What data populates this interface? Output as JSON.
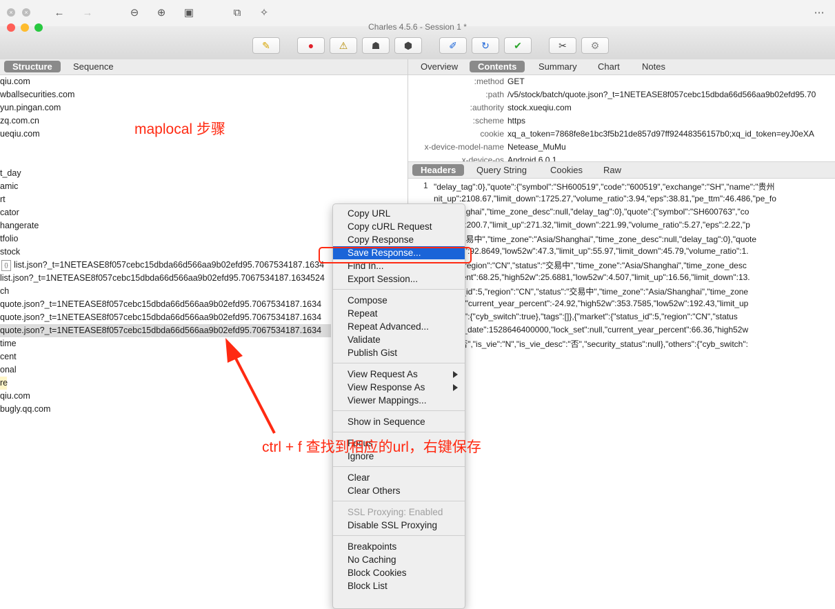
{
  "window": {
    "title": "Charles 4.5.6 - Session 1 *"
  },
  "left_tabs": [
    "Structure",
    "Sequence"
  ],
  "tree": [
    "qiu.com",
    "wballsecurities.com",
    "yun.pingan.com",
    "zq.com.cn",
    "ueqiu.com",
    "",
    "",
    "t_day",
    "amic",
    "rt",
    "cator",
    "hangerate",
    "tfolio",
    "stock",
    "list.json?_t=1NETEASE8f057cebc15dbda66d566aa9b02efd95.7067534187.1634",
    "list.json?_t=1NETEASE8f057cebc15dbda66d566aa9b02efd95.7067534187.1634524",
    "ch",
    "quote.json?_t=1NETEASE8f057cebc15dbda66d566aa9b02efd95.7067534187.1634",
    "quote.json?_t=1NETEASE8f057cebc15dbda66d566aa9b02efd95.7067534187.1634",
    "quote.json?_t=1NETEASE8f057cebc15dbda66d566aa9b02efd95.7067534187.1634",
    "time",
    "cent",
    "onal",
    "re",
    "qiu.com",
    "bugly.qq.com"
  ],
  "right_tabs": [
    "Overview",
    "Contents",
    "Summary",
    "Chart",
    "Notes"
  ],
  "request_headers": [
    {
      "key": ":method",
      "value": "GET"
    },
    {
      "key": ":path",
      "value": "/v5/stock/batch/quote.json?_t=1NETEASE8f057cebc15dbda66d566aa9b02efd95.70"
    },
    {
      "key": ":authority",
      "value": "stock.xueqiu.com"
    },
    {
      "key": ":scheme",
      "value": "https"
    },
    {
      "key": "cookie",
      "value": "xq_a_token=7868fe8e1bc3f5b21de857d97ff92448356157b0;xq_id_token=eyJ0eXA"
    },
    {
      "key": "x-device-model-name",
      "value": "Netease_MuMu"
    },
    {
      "key": "x-device-os",
      "value": "Android 6.0.1"
    }
  ],
  "bottom_tabs": [
    "Headers",
    "Query String",
    "Cookies",
    "Raw"
  ],
  "line_number": "1",
  "response_lines": [
    "\"delay_tag\":0},\"quote\":{\"symbol\":\"SH600519\",\"code\":\"600519\",\"exchange\":\"SH\",\"name\":\"贵州",
    "nit_up\":2108.67,\"limit_down\":1725.27,\"volume_ratio\":3.94,\"eps\":38.81,\"pe_ttm\":46.486,\"pe_fo",
    "sia/Shanghai\",\"time_zone_desc\":null,\"delay_tag\":0},\"quote\":{\"symbol\":\"SH600763\",\"co",
    "low52w\":200.7,\"limit_up\":271.32,\"limit_down\":221.99,\"volume_ratio\":5.27,\"eps\":2.22,\"p",
    "atus\":\"交易中\",\"time_zone\":\"Asia/Shanghai\",\"time_zone_desc\":null,\"delay_tag\":0},\"quote",
    "high52w\":92.8649,\"low52w\":47.3,\"limit_up\":55.97,\"limit_down\":45.79,\"volume_ratio\":1.",
    "s_id\":5,\"region\":\"CN\",\"status\":\"交易中\",\"time_zone\":\"Asia/Shanghai\",\"time_zone_desc",
    "ar_percent\":68.25,\"high52w\":25.6881,\"low52w\":4.507,\"limit_up\":16.56,\"limit_down\":13.",
    "{\"status_id\":5,\"region\":\"CN\",\"status\":\"交易中\",\"time_zone\":\"Asia/Shanghai\",\"time_zone",
    "set\":null,\"current_year_percent\":-24.92,\"high52w\":353.7585,\"low52w\":192.43,\"limit_up",
    "},\"others\":{\"cyb_switch\":true},\"tags\":[]},{\"market\":{\"status_id\":5,\"region\":\"CN\",\"status",
    "2,\"issue_date\":1528646400000,\"lock_set\":null,\"current_year_percent\":66.36,\"high52w",
    "desc\":\"否\",\"is_vie\":\"N\",\"is_vie_desc\":\"否\",\"security_status\":null},\"others\":{\"cyb_switch\":"
  ],
  "context_menu": {
    "groups": [
      [
        "Copy URL",
        "Copy cURL Request",
        "Copy Response",
        "Save Response...",
        "Find In...",
        "Export Session..."
      ],
      [
        "Compose",
        "Repeat",
        "Repeat Advanced...",
        "Validate",
        "Publish Gist"
      ],
      [
        "View Request As",
        "View Response As",
        "Viewer Mappings..."
      ],
      [
        "Show in Sequence"
      ],
      [
        "Focus",
        "Ignore"
      ],
      [
        "Clear",
        "Clear Others"
      ],
      [
        "SSL Proxying: Enabled",
        "Disable SSL Proxying"
      ],
      [
        "Breakpoints",
        "No Caching",
        "Block Cookies",
        "Block List"
      ]
    ],
    "highlighted": "Save Response...",
    "submenus": [
      "View Request As",
      "View Response As"
    ],
    "disabled": [
      "SSL Proxying: Enabled"
    ]
  },
  "annotations": {
    "note1": "maplocal 步骤",
    "note2": "ctrl + f 查找到相应的url，右键保存",
    "color": "#ff2a12"
  },
  "colors": {
    "accent": "#1a64d8",
    "annotation": "#ff2a12"
  }
}
